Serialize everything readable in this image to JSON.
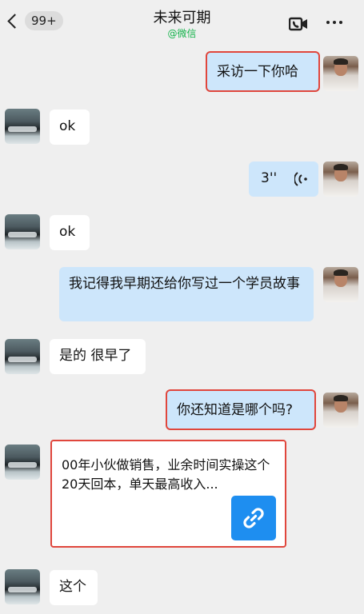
{
  "header": {
    "back_badge": "99+",
    "title": "未来可期",
    "subtitle": "@微信"
  },
  "messages": {
    "m1": "采访一下你哈",
    "m2": "ok",
    "m3_duration": "3''",
    "m4": "ok",
    "m5": "我记得我早期还给你写过一个学员故事",
    "m6": "是的 很早了",
    "m7": "你还知道是哪个吗?",
    "m8_link_text": "00年小伙做销售，业余时间实操这个20天回本，单天最高收入...",
    "m9": "这个"
  },
  "colors": {
    "self_bubble": "#cde6fb",
    "other_bubble": "#ffffff",
    "highlight": "#e0463c",
    "link_icon_bg": "#1e8ef0",
    "subtitle": "#13b34a"
  }
}
